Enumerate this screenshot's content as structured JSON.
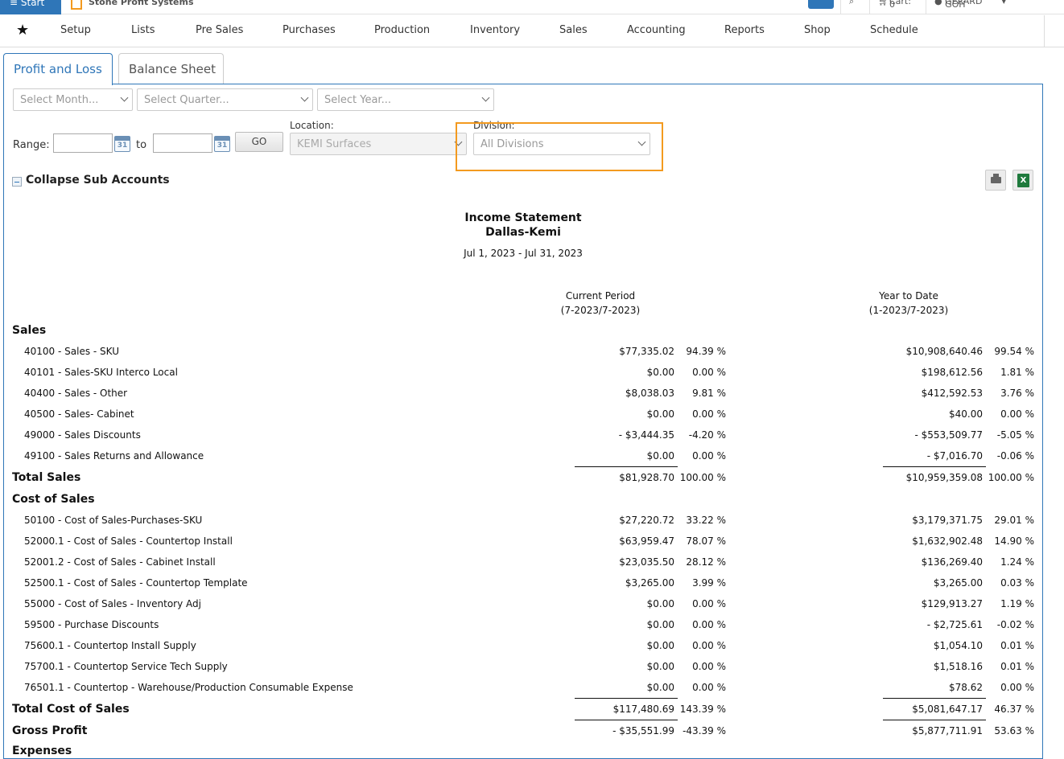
{
  "topbar": {
    "start_label": "≡ Start",
    "brand": "Stone Profit Systems",
    "cart": "Cart: 0",
    "user": "GERARD GOH"
  },
  "menu": [
    "Setup",
    "Lists",
    "Pre Sales",
    "Purchases",
    "Production",
    "Inventory",
    "Sales",
    "Accounting",
    "Reports",
    "Shop",
    "Schedule"
  ],
  "tabs": {
    "profit_loss": "Profit and Loss",
    "balance_sheet": "Balance Sheet"
  },
  "filters": {
    "month_placeholder": "Select Month...",
    "quarter_placeholder": "Select Quarter...",
    "year_placeholder": "Select Year...",
    "range_label": "Range:",
    "to_label": "to",
    "calendar_day": "31",
    "go_label": "GO",
    "location_label": "Location:",
    "location_value": "KEMI Surfaces",
    "division_label": "Division:",
    "division_value": "All Divisions"
  },
  "collapse_label": "Collapse Sub Accounts",
  "report": {
    "title": "Income Statement",
    "subtitle": "Dallas-Kemi",
    "date_range": "Jul 1, 2023 - Jul 31, 2023",
    "current_period_label": "Current Period",
    "current_period_range": "(7-2023/7-2023)",
    "ytd_label": "Year to Date",
    "ytd_range": "(1-2023/7-2023)",
    "sections": {
      "sales": "Sales",
      "total_sales": "Total Sales",
      "cost_of_sales": "Cost of Sales",
      "total_cost_of_sales": "Total Cost of Sales",
      "gross_profit": "Gross Profit",
      "expenses": "Expenses"
    },
    "sales_rows": [
      {
        "name": "40100 - Sales - SKU",
        "cur": "$77,335.02",
        "cur_pct": "94.39 %",
        "ytd": "$10,908,640.46",
        "ytd_pct": "99.54 %"
      },
      {
        "name": "40101 - Sales-SKU Interco Local",
        "cur": "$0.00",
        "cur_pct": "0.00 %",
        "ytd": "$198,612.56",
        "ytd_pct": "1.81 %"
      },
      {
        "name": "40400 - Sales - Other",
        "cur": "$8,038.03",
        "cur_pct": "9.81 %",
        "ytd": "$412,592.53",
        "ytd_pct": "3.76 %"
      },
      {
        "name": "40500 - Sales- Cabinet",
        "cur": "$0.00",
        "cur_pct": "0.00 %",
        "ytd": "$40.00",
        "ytd_pct": "0.00 %"
      },
      {
        "name": "49000 - Sales Discounts",
        "cur": "- $3,444.35",
        "cur_pct": "-4.20 %",
        "ytd": "- $553,509.77",
        "ytd_pct": "-5.05 %"
      },
      {
        "name": "49100 - Sales Returns and Allowance",
        "cur": "$0.00",
        "cur_pct": "0.00 %",
        "ytd": "- $7,016.70",
        "ytd_pct": "-0.06 %"
      }
    ],
    "total_sales": {
      "cur": "$81,928.70",
      "cur_pct": "100.00 %",
      "ytd": "$10,959,359.08",
      "ytd_pct": "100.00 %"
    },
    "cos_rows": [
      {
        "name": "50100 - Cost of Sales-Purchases-SKU",
        "cur": "$27,220.72",
        "cur_pct": "33.22 %",
        "ytd": "$3,179,371.75",
        "ytd_pct": "29.01 %"
      },
      {
        "name": "52000.1 - Cost of Sales - Countertop Install",
        "cur": "$63,959.47",
        "cur_pct": "78.07 %",
        "ytd": "$1,632,902.48",
        "ytd_pct": "14.90 %"
      },
      {
        "name": "52001.2 - Cost of Sales - Cabinet Install",
        "cur": "$23,035.50",
        "cur_pct": "28.12 %",
        "ytd": "$136,269.40",
        "ytd_pct": "1.24 %"
      },
      {
        "name": "52500.1 - Cost of Sales - Countertop Template",
        "cur": "$3,265.00",
        "cur_pct": "3.99 %",
        "ytd": "$3,265.00",
        "ytd_pct": "0.03 %"
      },
      {
        "name": "55000 - Cost of Sales - Inventory Adj",
        "cur": "$0.00",
        "cur_pct": "0.00 %",
        "ytd": "$129,913.27",
        "ytd_pct": "1.19 %"
      },
      {
        "name": "59500 - Purchase Discounts",
        "cur": "$0.00",
        "cur_pct": "0.00 %",
        "ytd": "- $2,725.61",
        "ytd_pct": "-0.02 %"
      },
      {
        "name": "75600.1 - Countertop Install Supply",
        "cur": "$0.00",
        "cur_pct": "0.00 %",
        "ytd": "$1,054.10",
        "ytd_pct": "0.01 %"
      },
      {
        "name": "75700.1 - Countertop Service Tech Supply",
        "cur": "$0.00",
        "cur_pct": "0.00 %",
        "ytd": "$1,518.16",
        "ytd_pct": "0.01 %"
      },
      {
        "name": "76501.1 - Countertop - Warehouse/Production Consumable Expense",
        "cur": "$0.00",
        "cur_pct": "0.00 %",
        "ytd": "$78.62",
        "ytd_pct": "0.00 %"
      }
    ],
    "total_cos": {
      "cur": "$117,480.69",
      "cur_pct": "143.39 %",
      "ytd": "$5,081,647.17",
      "ytd_pct": "46.37 %"
    },
    "gross_profit": {
      "cur": "- $35,551.99",
      "cur_pct": "-43.39 %",
      "ytd": "$5,877,711.91",
      "ytd_pct": "53.63 %"
    }
  },
  "colors": {
    "accent": "#2f76b8",
    "highlight": "#f39a1f",
    "excel": "#1f7a3d"
  }
}
